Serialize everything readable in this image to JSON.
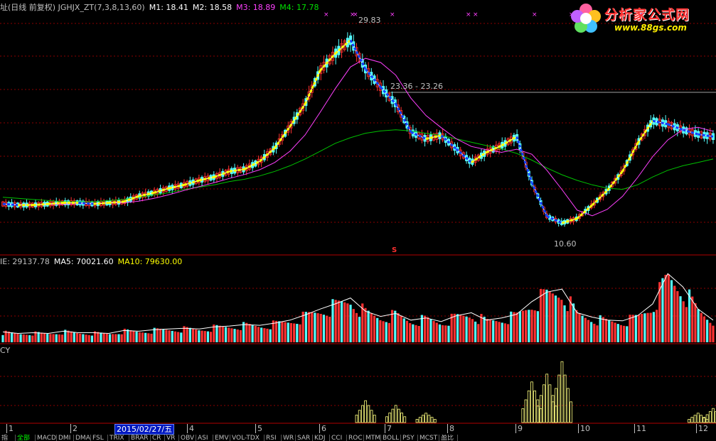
{
  "main_legend": [
    {
      "text": "址(日线 前复权) JGHJX_ZT(7,3,8,13,60)",
      "color": "#c0c0c0"
    },
    {
      "text": "M1: 18.41",
      "color": "#ffffff"
    },
    {
      "text": "M2: 18.58",
      "color": "#ffffff"
    },
    {
      "text": "M3: 18.89",
      "color": "#ff40ff"
    },
    {
      "text": "M4: 17.78",
      "color": "#00e000"
    }
  ],
  "vol_legend": [
    {
      "text": "IE: 29137.78",
      "color": "#c0c0c0"
    },
    {
      "text": "MA5: 70021.60",
      "color": "#ffffff"
    },
    {
      "text": "MA10: 79630.00",
      "color": "#ffff00"
    }
  ],
  "ind_legend": "CY",
  "annotations": {
    "high": "29.83",
    "level": "23.36 - 23.26",
    "low": "10.60",
    "marker": "S"
  },
  "logo": {
    "brand": "分析家公式网",
    "url": "www.88gs.com"
  },
  "x_axis": {
    "labels": [
      "1",
      "2",
      "4",
      "5",
      "6",
      "7",
      "8",
      "9",
      "10",
      "11",
      "12"
    ],
    "cursor_date": "2015/02/27/五"
  },
  "tabs": [
    "指标",
    "全部",
    "MACD",
    "DMI",
    "DMA",
    "FSL",
    "TRIX",
    "BRAR",
    "CR",
    "VR",
    "OBV",
    "ASI",
    "EMV",
    "VOL-TDX",
    "RSI",
    "WR",
    "SAR",
    "KDJ",
    "CCI",
    "ROC",
    "MTM",
    "BOLL",
    "PSY",
    "MCST",
    "盈比"
  ],
  "colors": {
    "up": "#ff3232",
    "down": "#54ffff",
    "ma_white": "#ffffff",
    "ma_magenta": "#ff40ff",
    "ma_green": "#00c000",
    "yellow": "#ffff00",
    "grid": "#8b0000"
  },
  "chart_data": [
    {
      "type": "candlestick",
      "title": "",
      "ylim": [
        9.5,
        30.5
      ],
      "series": [
        {
          "name": "M1",
          "values": [
            13.6,
            13.5,
            13.5,
            13.6,
            13.7,
            13.7,
            13.6,
            13.7,
            13.8,
            14.3,
            14.6,
            15.0,
            15.3,
            15.7,
            16.0,
            16.5,
            16.7,
            17.4,
            18.6,
            20.5,
            22.5,
            25.5,
            27.0,
            28.2,
            25.6,
            24.0,
            22.5,
            20.0,
            19.4,
            19.7,
            18.5,
            17.3,
            18.2,
            18.8,
            19.6,
            15.5,
            12.5,
            11.9,
            12.3,
            13.5,
            14.8,
            16.5,
            19.0,
            21.0,
            20.7,
            20.2,
            19.8,
            19.6
          ]
        },
        {
          "name": "M4",
          "values": [
            14.2,
            14.1,
            14.0,
            13.9,
            13.8,
            13.8,
            13.8,
            13.9,
            14.0,
            14.2,
            14.4,
            14.6,
            14.9,
            15.1,
            15.3,
            15.6,
            15.8,
            16.1,
            16.5,
            17.0,
            17.6,
            18.3,
            19.0,
            19.5,
            19.9,
            20.1,
            20.2,
            20.1,
            19.9,
            19.7,
            19.4,
            19.1,
            18.8,
            18.5,
            18.1,
            17.5,
            16.8,
            16.2,
            15.7,
            15.3,
            15.0,
            14.9,
            15.3,
            16.0,
            16.6,
            17.0,
            17.3,
            17.6
          ]
        }
      ]
    },
    {
      "type": "bar",
      "title": "",
      "series": [
        {
          "name": "VOL",
          "values": [
            14,
            12,
            13,
            12,
            15,
            13,
            13,
            12,
            16,
            15,
            17,
            18,
            19,
            18,
            21,
            22,
            24,
            23,
            26,
            30,
            37,
            45,
            52,
            60,
            42,
            35,
            39,
            30,
            33,
            28,
            36,
            40,
            30,
            33,
            38,
            55,
            68,
            72,
            40,
            34,
            30,
            29,
            36,
            52,
            93,
            75,
            45,
            30
          ]
        }
      ]
    },
    {
      "type": "bar",
      "title": "",
      "series": [
        {
          "name": "CY",
          "values": [
            0,
            0,
            0,
            0,
            0,
            0,
            0,
            0,
            0,
            0,
            0,
            0,
            0,
            0,
            0,
            0,
            0,
            0,
            0,
            0,
            0,
            0,
            0,
            0,
            28,
            0,
            22,
            0,
            12,
            0,
            0,
            0,
            0,
            0,
            0,
            52,
            62,
            78,
            0,
            0,
            0,
            0,
            0,
            0,
            0,
            0,
            12,
            18
          ]
        }
      ]
    }
  ]
}
